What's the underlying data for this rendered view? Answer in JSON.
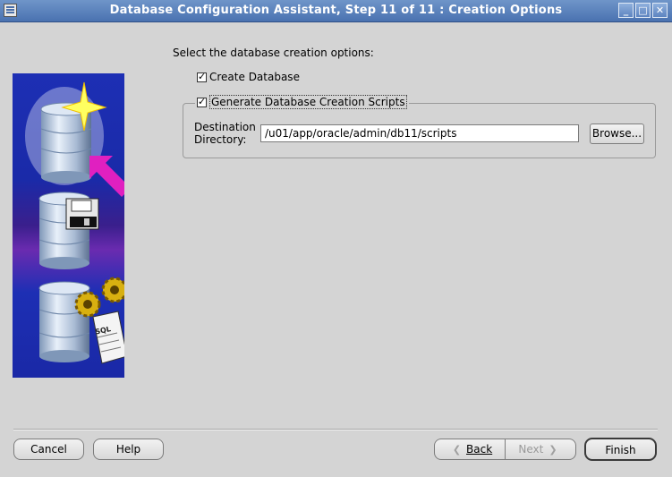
{
  "window": {
    "title": "Database Configuration Assistant, Step 11 of 11 : Creation Options",
    "controls": {
      "minimize": "_",
      "maximize": "□",
      "close": "✕"
    }
  },
  "main": {
    "prompt": "Select the database creation options:",
    "options": {
      "create_database": {
        "label": "Create Database",
        "checked": true
      },
      "generate_scripts": {
        "label": "Generate Database Creation Scripts",
        "checked": true
      }
    },
    "destination": {
      "label_line1": "Destination",
      "label_line2": "Directory:",
      "value": "/u01/app/oracle/admin/db11/scripts",
      "browse_label": "Browse..."
    }
  },
  "side_image": {
    "sql_label": "SQL"
  },
  "footer": {
    "cancel_label": "Cancel",
    "help_label": "Help",
    "back_label": "Back",
    "next_label": "Next",
    "finish_label": "Finish"
  },
  "colors": {
    "title_bar": "#4a72b0",
    "panel_background": "#d4d4d4",
    "image_blue": "#1d2fb4",
    "image_purple": "#6a2bb0",
    "arrow_magenta": "#e020c0",
    "gear_gold": "#d8b010"
  }
}
